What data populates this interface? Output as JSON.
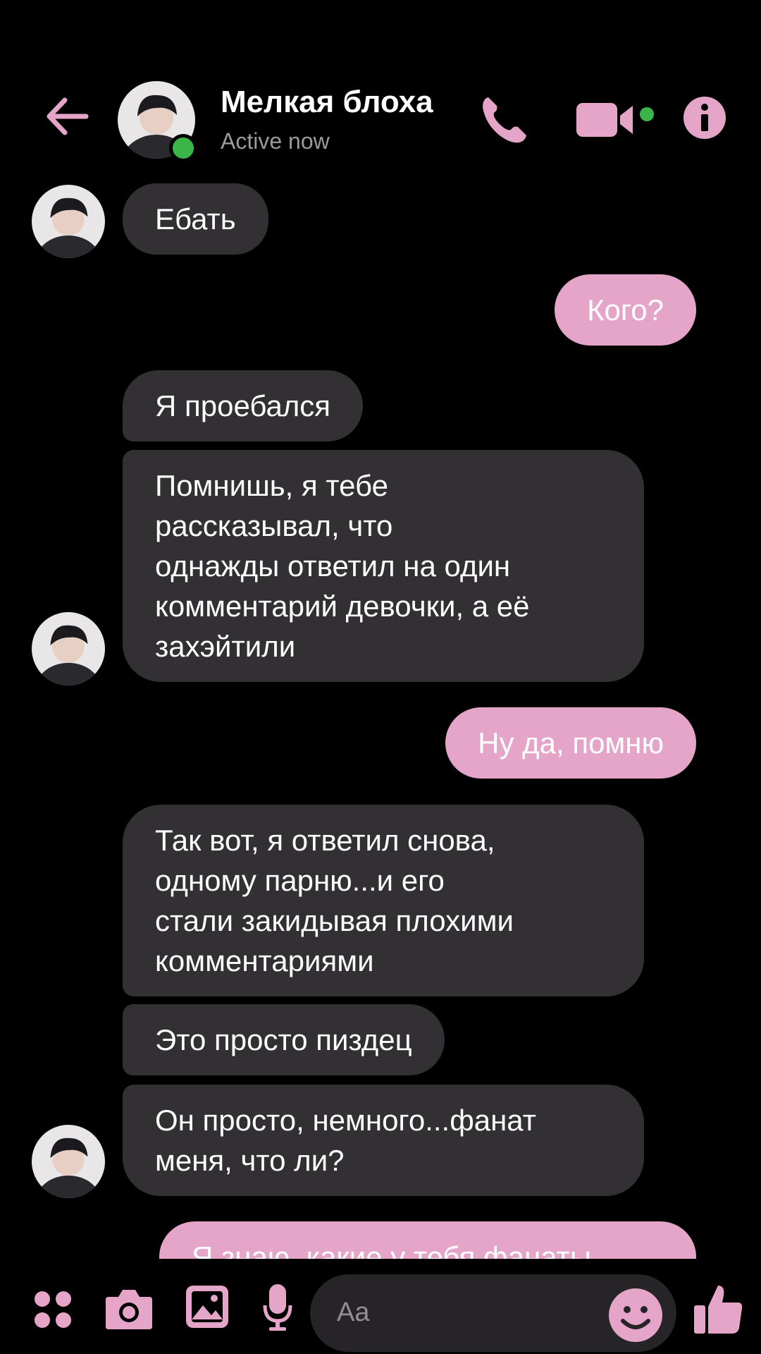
{
  "header": {
    "contact_name": "Мелкая блоха",
    "status": "Active now",
    "icons": [
      "back-arrow-icon",
      "phone-icon",
      "video-camera-icon",
      "info-icon"
    ]
  },
  "messages": [
    {
      "side": "in",
      "text": "Ебать"
    },
    {
      "side": "out",
      "text": "Кого?"
    },
    {
      "side": "in",
      "text": "Я проебался"
    },
    {
      "side": "in",
      "text": "Помнишь, я тебе\nрассказывал, что\nоднажды ответил на один\nкомментарий девочки, а её\nзахэйтили"
    },
    {
      "side": "out",
      "text": "Ну да, помню"
    },
    {
      "side": "in",
      "text": "Так вот, я ответил снова,\nодному парню...и его\nстали закидывая плохими\nкомментариями"
    },
    {
      "side": "in",
      "text": "Это просто пиздец"
    },
    {
      "side": "in",
      "text": "Он просто, немного...фанат\nменя, что ли?"
    },
    {
      "side": "out",
      "text": "Я знаю, какие у тебя фанаты"
    }
  ],
  "composer": {
    "placeholder": "Aa",
    "icons": [
      "apps-grid-icon",
      "camera-icon",
      "gallery-icon",
      "microphone-icon",
      "emoji-icon",
      "thumbs-up-icon"
    ]
  },
  "colors": {
    "accent": "#e4a5c9",
    "incoming_bubble": "#323032",
    "background": "#000000",
    "online": "#3bb54a"
  }
}
